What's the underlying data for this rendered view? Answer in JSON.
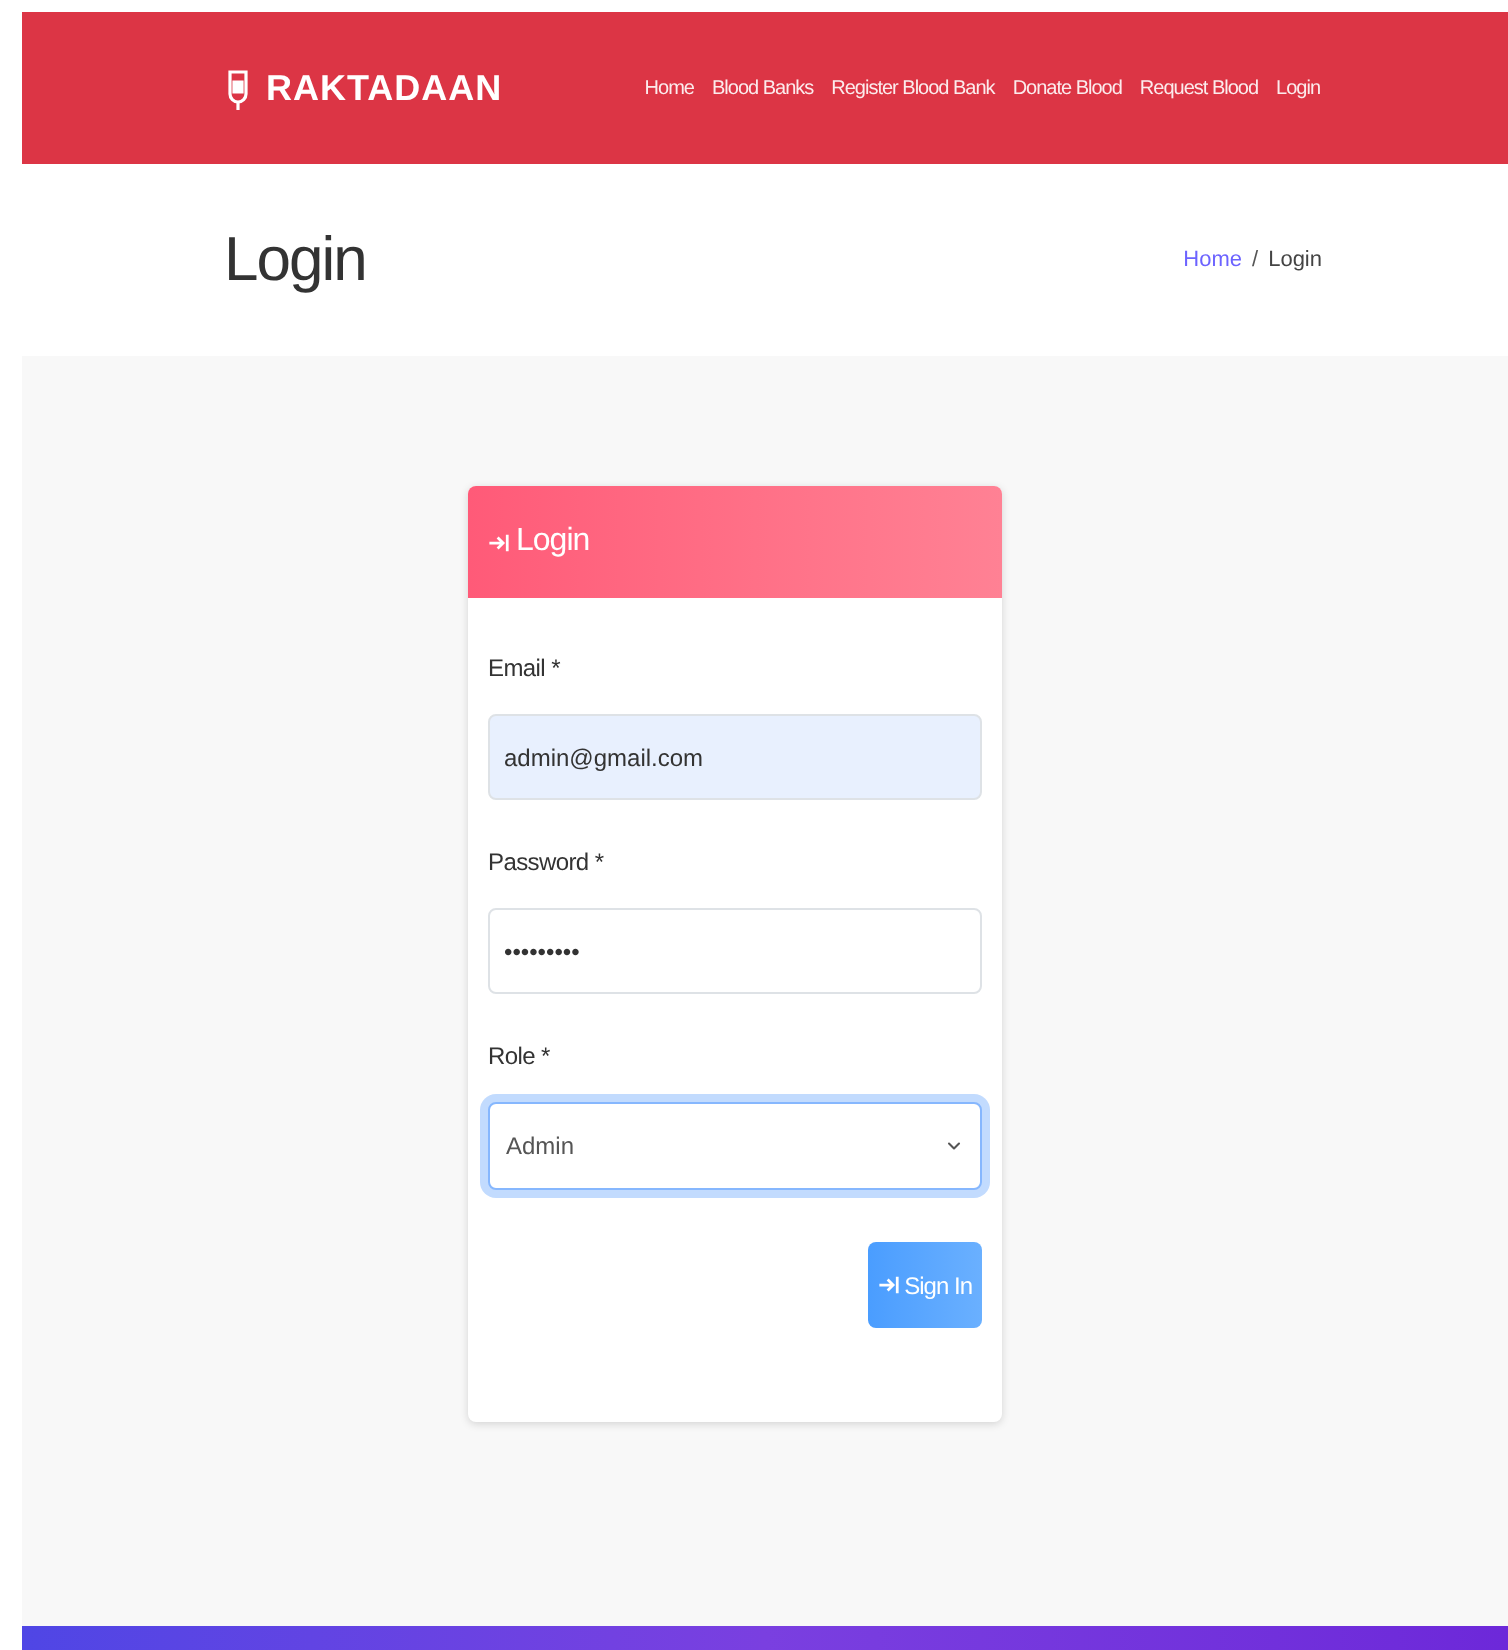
{
  "navbar": {
    "brand": "RAKTADAAN",
    "links": [
      "Home",
      "Blood Banks",
      "Register Blood Bank",
      "Donate Blood",
      "Request Blood",
      "Login"
    ]
  },
  "page_header": {
    "title": "Login",
    "breadcrumb": [
      {
        "label": "Home",
        "kind": "link"
      },
      {
        "label": "/",
        "kind": "separator"
      },
      {
        "label": "Login",
        "kind": "current"
      }
    ]
  },
  "login_card": {
    "title": "Login",
    "fields": [
      {
        "kind": "input",
        "label": "Email",
        "required_mark": "*",
        "value": "admin@gmail.com",
        "autofilled": true,
        "focused": false
      },
      {
        "kind": "input",
        "label": "Password",
        "required_mark": "*",
        "value": "•••••••••",
        "autofilled": false,
        "focused": false
      },
      {
        "kind": "select",
        "label": "Role",
        "required_mark": "*",
        "value": "Admin",
        "autofilled": false,
        "focused": true
      }
    ],
    "submit": "Sign In"
  }
}
